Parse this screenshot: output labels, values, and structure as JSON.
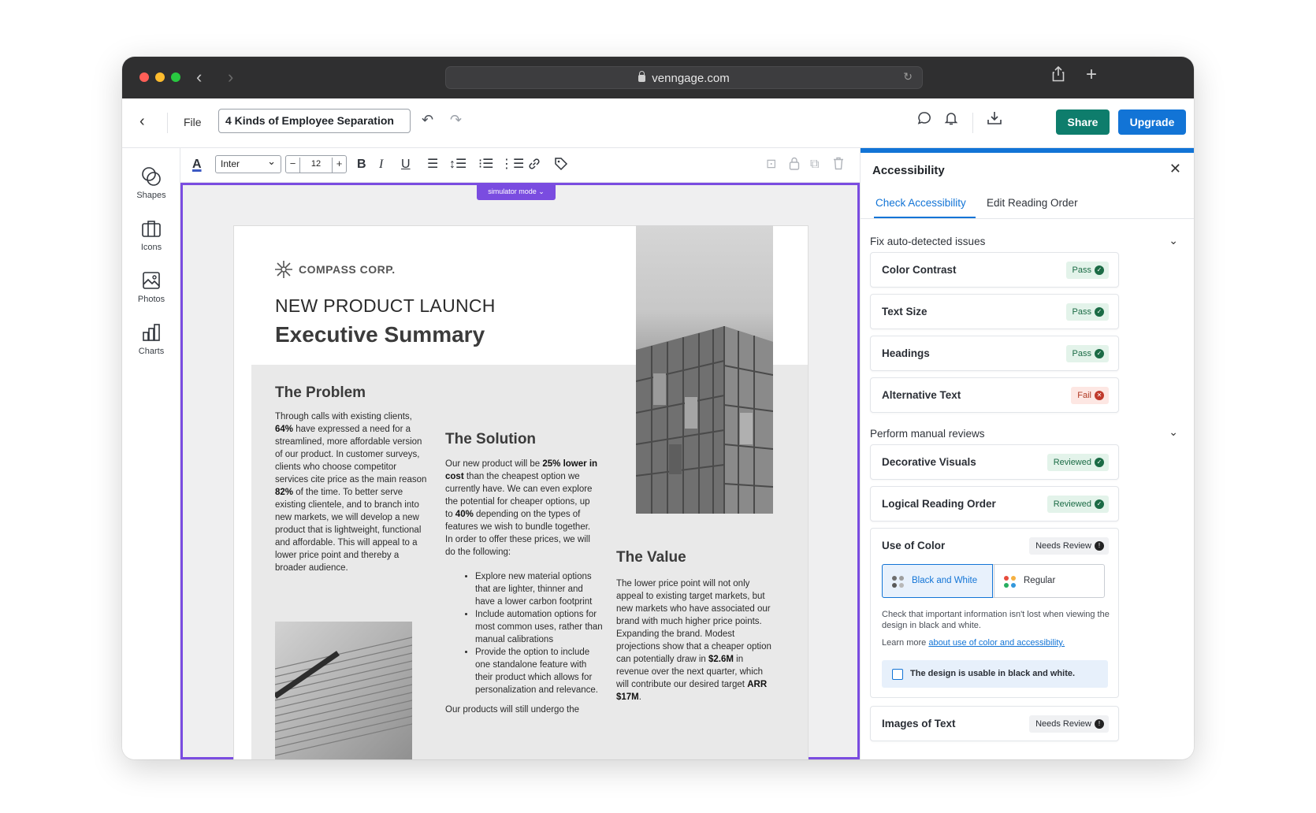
{
  "browser": {
    "url": "venngage.com"
  },
  "topbar": {
    "file_label": "File",
    "doc_title": "4 Kinds of Employee Separation",
    "share_label": "Share",
    "upgrade_label": "Upgrade",
    "colors": {
      "share": "#0e7d6c",
      "upgrade": "#1274d6"
    }
  },
  "rail": {
    "items": [
      {
        "label": "Shapes",
        "icon": "shapes-icon"
      },
      {
        "label": "Icons",
        "icon": "briefcase-icon"
      },
      {
        "label": "Photos",
        "icon": "image-icon"
      },
      {
        "label": "Charts",
        "icon": "bar-chart-icon"
      }
    ]
  },
  "format": {
    "font": "Inter",
    "font_size": "12",
    "minus": "−",
    "plus": "+",
    "bold": "B",
    "italic": "I",
    "underline": "U"
  },
  "canvas": {
    "simulator_label": "simulator mode",
    "accent": "#7a4ce0",
    "doc": {
      "logo": "COMPASS CORP.",
      "kicker": "NEW PRODUCT LAUNCH",
      "heading": "Executive Summary",
      "problem": {
        "title": "The Problem"
      },
      "solution": {
        "title": "The Solution",
        "bullets": [
          "Explore new material options that are lighter, thinner and have a lower carbon footprint",
          "Include automation options for most common uses, rather than manual calibrations",
          "Provide the option to include one standalone feature with their product which allows for personalization and relevance."
        ],
        "footer": "Our products will still undergo the"
      },
      "value": {
        "title": "The Value"
      }
    }
  },
  "panel": {
    "title": "Accessibility",
    "tabs": [
      "Check Accessibility",
      "Edit Reading Order"
    ],
    "auto_group": "Fix auto-detected issues",
    "auto_checks": [
      {
        "label": "Color Contrast",
        "status": "Pass"
      },
      {
        "label": "Text Size",
        "status": "Pass"
      },
      {
        "label": "Headings",
        "status": "Pass"
      },
      {
        "label": "Alternative Text",
        "status": "Fail"
      }
    ],
    "manual_group": "Perform manual reviews",
    "manual_checks": [
      {
        "label": "Decorative Visuals",
        "status": "Reviewed"
      },
      {
        "label": "Logical Reading Order",
        "status": "Reviewed"
      }
    ],
    "use_of_color": {
      "label": "Use of Color",
      "status": "Needs Review",
      "option_bw": "Black and White",
      "option_regular": "Regular",
      "help": "Check that important information isn't lost when viewing the design in black and white.",
      "learn_prefix": "Learn more",
      "learn_link": "about use of color and accessibility.",
      "confirm": "The design is usable in black and white."
    },
    "next_check": {
      "label": "Images of Text",
      "status": "Needs Review"
    },
    "colors": {
      "accent": "#1274d6",
      "pass": "#1b6b45",
      "fail": "#c0392b"
    }
  }
}
